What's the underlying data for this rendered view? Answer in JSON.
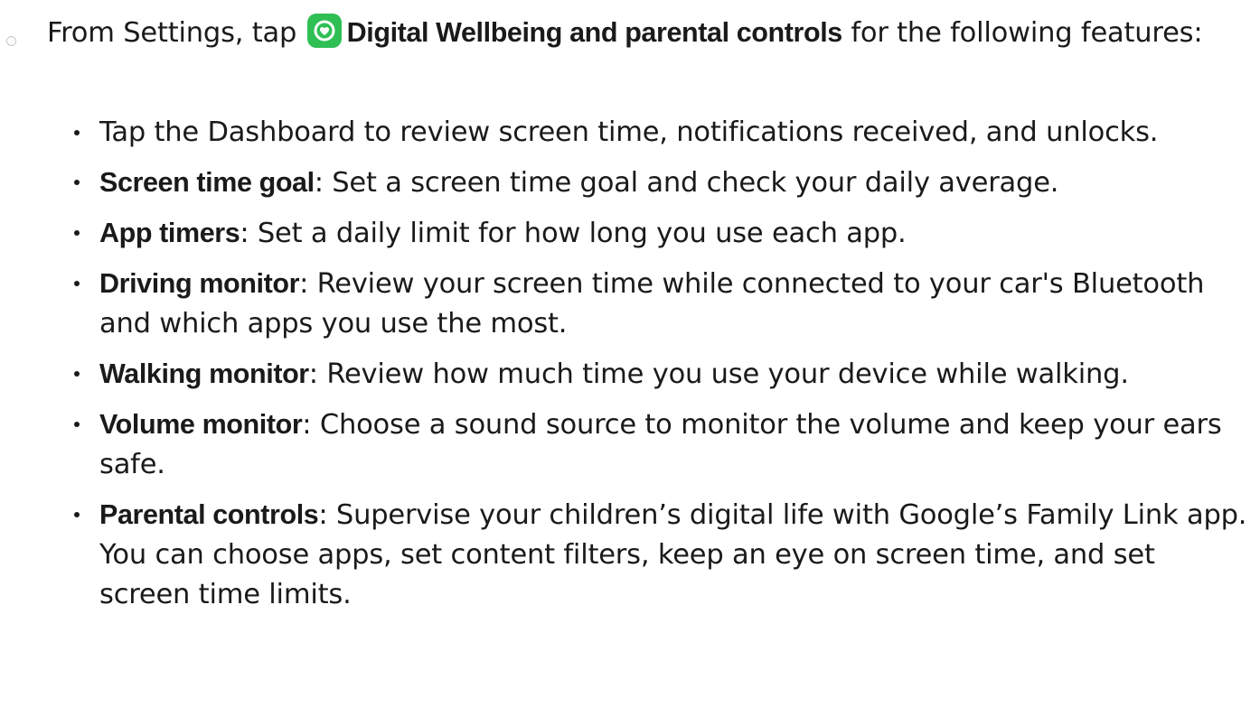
{
  "step": {
    "text_before": "From Settings, tap",
    "app_name": "Digital Wellbeing and parental controls",
    "text_after": "for the following features:",
    "icon": "digital-wellbeing-icon",
    "icon_color": "#2fbf55"
  },
  "items": [
    {
      "term": "",
      "separator": "",
      "desc": "Tap the Dashboard to review screen time, notifications received, and unlocks."
    },
    {
      "term": "Screen time goal",
      "separator": ":",
      "desc": " Set a screen time goal and check your daily average."
    },
    {
      "term": "App timers",
      "separator": ":",
      "desc": " Set a daily limit for how long you use each app."
    },
    {
      "term": "Driving monitor",
      "separator": ":",
      "desc": " Review your screen time while connected to your car's Bluetooth and which apps you use the most."
    },
    {
      "term": "Walking monitor",
      "separator": ":",
      "desc": " Review how much time you use your device while walking."
    },
    {
      "term": "Volume monitor",
      "separator": ":",
      "desc": " Choose a sound source to monitor the volume and keep your ears safe."
    },
    {
      "term": "Parental controls",
      "separator": ":",
      "desc": " Supervise your children’s digital life with Google’s Family Link app. You can choose apps, set content filters, keep an eye on screen time, and set screen time limits."
    }
  ]
}
